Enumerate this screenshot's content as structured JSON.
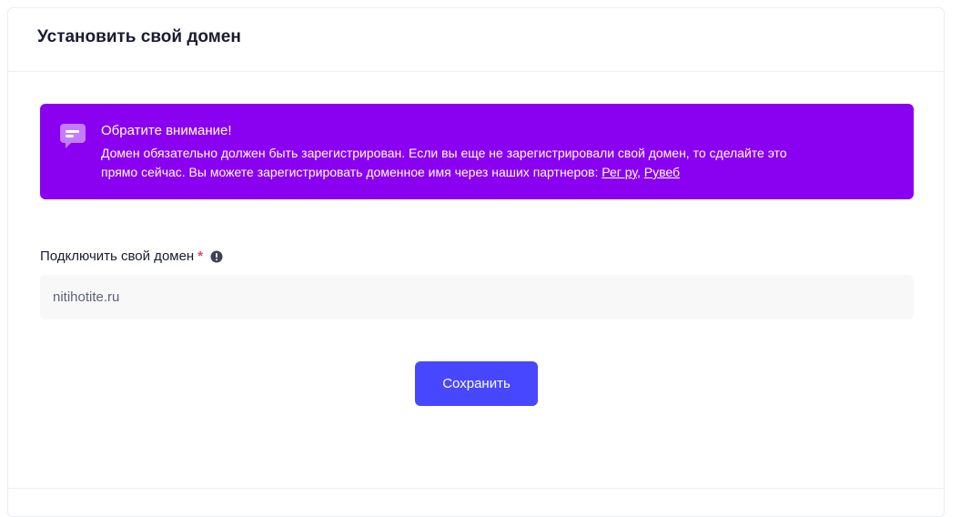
{
  "card": {
    "title": "Установить свой домен"
  },
  "notice": {
    "icon": "message-icon",
    "title": "Обратите внимание!",
    "text_line1": "Домен обязательно должен быть зарегистрирован. Если вы еще не зарегистрировали свой домен, то сделайте это",
    "text_line2_prefix": "прямо сейчас. Вы можете зарегистрировать доменное имя через наших партнеров: ",
    "link1": "Рег ру",
    "separator": ", ",
    "link2": "Рувеб",
    "background_color": "#8a00f0"
  },
  "domain_field": {
    "label": "Подключить свой домен",
    "required_mark": "*",
    "info_icon": "info-icon",
    "value": "nitihotite.ru",
    "placeholder": ""
  },
  "actions": {
    "save_label": "Сохранить",
    "accent_color": "#4747ff"
  }
}
